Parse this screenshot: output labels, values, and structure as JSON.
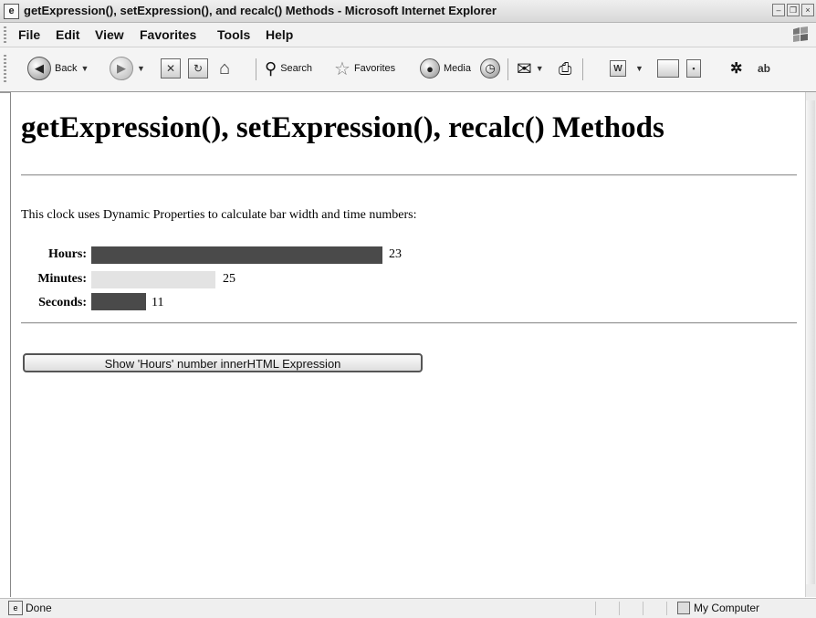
{
  "window": {
    "title": "getExpression(), setExpression(), and recalc() Methods - Microsoft Internet Explorer",
    "icon": "ie-icon"
  },
  "menu": [
    "File",
    "Edit",
    "View",
    "Favorites",
    "Tools",
    "Help"
  ],
  "toolbar": {
    "back_label": "Back",
    "search_label": "Search",
    "favorites_label": "Favorites",
    "media_label": "Media"
  },
  "page": {
    "heading": "getExpression(), setExpression(), recalc() Methods",
    "intro": "This clock uses Dynamic Properties to calculate bar width and time numbers:",
    "clock": [
      {
        "label": "Hours:",
        "value": "23",
        "color": "#4a4a4a"
      },
      {
        "label": "Minutes:",
        "value": "25",
        "color": "#e3e3e3"
      },
      {
        "label": "Seconds:",
        "value": "11",
        "color": "#4a4a4a"
      }
    ],
    "button_label": "Show 'Hours' number innerHTML Expression"
  },
  "status": {
    "text": "Done",
    "zone": "My Computer"
  }
}
